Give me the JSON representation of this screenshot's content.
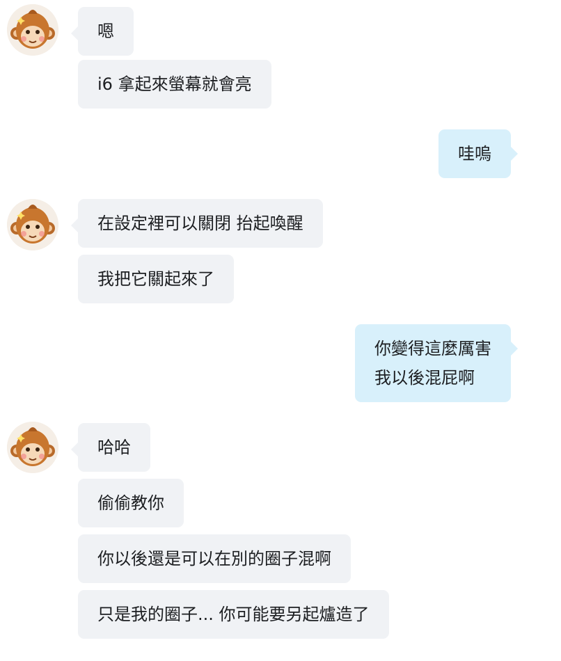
{
  "colors": {
    "incoming_bubble": "#f0f2f5",
    "outgoing_bubble": "#d8f0fb",
    "text": "#1c1e21"
  },
  "avatar_icon": "monkey-avatar",
  "messages": {
    "g1": [
      "嗯",
      "i6 拿起來螢幕就會亮"
    ],
    "o1": [
      "哇嗚"
    ],
    "g2": [
      "在設定裡可以關閉 抬起喚醒",
      "我把它關起來了"
    ],
    "o2": [
      "你變得這麼厲害",
      "我以後混屁啊"
    ],
    "g3": [
      "哈哈",
      "偷偷教你",
      "你以後還是可以在別的圈子混啊",
      "只是我的圈子... 你可能要另起爐造了"
    ]
  }
}
